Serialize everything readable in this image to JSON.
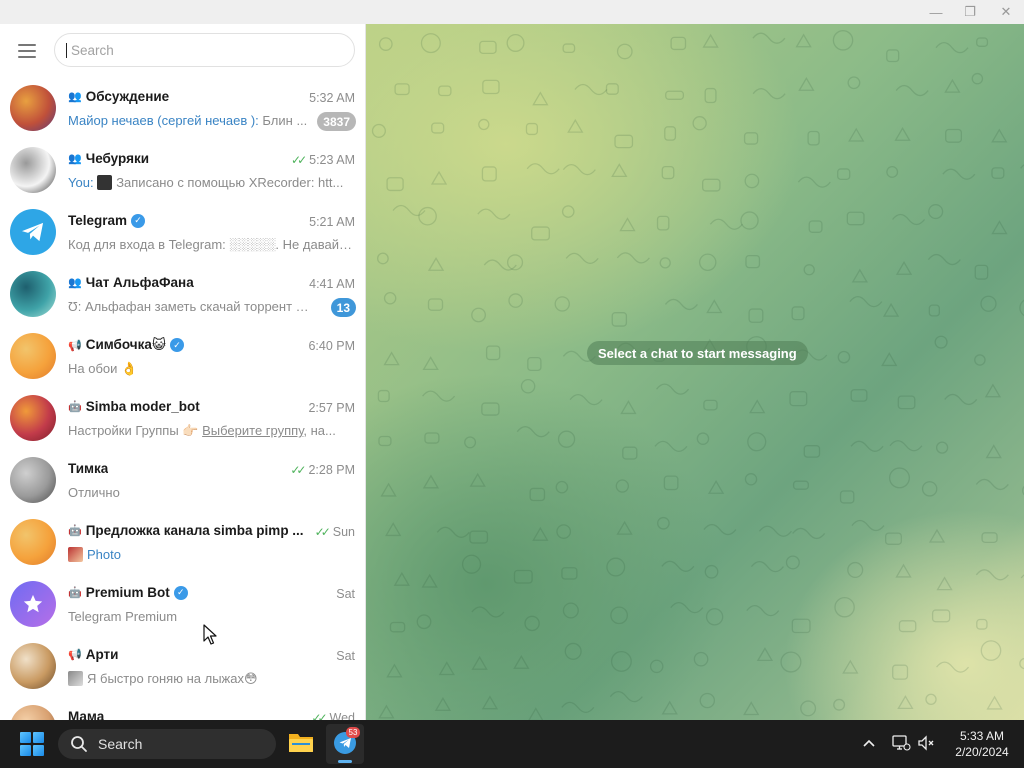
{
  "window": {
    "minimize_glyph": "—",
    "maximize_glyph": "❐",
    "close_glyph": "✕"
  },
  "sidebar": {
    "menu_icon": "hamburger-icon",
    "search": {
      "placeholder": "Search",
      "value": ""
    }
  },
  "chats": [
    {
      "name": "Обсуждение",
      "type": "group",
      "verified": false,
      "time": "5:32 AM",
      "status": "",
      "sender": "Майор нечаев (сергей нечаев ):",
      "preview": "Блин ...",
      "media": "",
      "badge": "3837",
      "badge_muted": true,
      "avatar_colors": [
        "#c0503a",
        "#e8a040",
        "#5a3a7a"
      ]
    },
    {
      "name": "Чебуряки",
      "type": "group",
      "verified": false,
      "time": "5:23 AM",
      "status": "read",
      "sender": "You:",
      "preview": "Записано с помощью XRecorder: htt...",
      "media": "thumb-dark",
      "badge": "",
      "badge_muted": false,
      "avatar_colors": [
        "#f4f4f4",
        "#999999",
        "#333333"
      ]
    },
    {
      "name": "Telegram",
      "type": "user",
      "verified": true,
      "time": "5:21 AM",
      "status": "",
      "sender": "",
      "preview": "Код для входа в Telegram: ░░░░░. Не давайте ...",
      "media": "",
      "badge": "",
      "badge_muted": false,
      "avatar_colors": [
        "#2ea6e6",
        "#2ea6e6",
        "#ffffff"
      ]
    },
    {
      "name": "Чат АльфаФана",
      "type": "group",
      "verified": false,
      "time": "4:41 AM",
      "status": "",
      "sender": "",
      "preview": "Ʊ: Альфафан заметь скачай торрент он...",
      "media": "",
      "badge": "13",
      "badge_muted": false,
      "avatar_colors": [
        "#3fa3a8",
        "#1e5f6e",
        "#a8e0d8"
      ]
    },
    {
      "name": "Симбочка😺",
      "type": "channel",
      "verified": true,
      "time": "6:40 PM",
      "status": "",
      "sender": "",
      "preview": "На обои 👌",
      "media": "",
      "badge": "",
      "badge_muted": false,
      "avatar_colors": [
        "#f5a23c",
        "#f2c46b",
        "#e07a2a"
      ]
    },
    {
      "name": "Simba moder_bot",
      "type": "bot",
      "verified": false,
      "time": "2:57 PM",
      "status": "",
      "sender": "",
      "preview": "Настройки Группы 👉🏻",
      "link": "Выберите группу",
      "preview_tail": ", на...",
      "media": "",
      "badge": "",
      "badge_muted": false,
      "avatar_colors": [
        "#c23b4a",
        "#f09a3a",
        "#7a1e2a"
      ]
    },
    {
      "name": "Тимка",
      "type": "user",
      "verified": false,
      "time": "2:28 PM",
      "status": "read",
      "sender": "",
      "preview": "Отлично",
      "media": "",
      "badge": "",
      "badge_muted": false,
      "avatar_colors": [
        "#9a9a9a",
        "#cfcfcf",
        "#4a4a4a"
      ]
    },
    {
      "name": "Предложка канала simba pimp ...",
      "type": "bot",
      "verified": false,
      "time": "Sun",
      "status": "read",
      "sender": "",
      "preview": "Photo",
      "media": "thumb-photo",
      "badge": "",
      "badge_muted": false,
      "preview_blue": true,
      "avatar_colors": [
        "#f5a23c",
        "#f2c46b",
        "#e07a2a"
      ]
    },
    {
      "name": "Premium Bot",
      "type": "bot",
      "verified": true,
      "time": "Sat",
      "status": "",
      "sender": "",
      "preview": "Telegram Premium",
      "media": "",
      "badge": "",
      "badge_muted": false,
      "avatar_colors": [
        "#6f6cf2",
        "#b66ee8",
        "#ffffff"
      ]
    },
    {
      "name": "Арти",
      "type": "channel",
      "verified": false,
      "time": "Sat",
      "status": "",
      "sender": "",
      "preview": "Я быстро гоняю на лыжах😳",
      "media": "thumb-small",
      "badge": "",
      "badge_muted": false,
      "avatar_colors": [
        "#c99a62",
        "#f0e0c8",
        "#6a4a2a"
      ]
    },
    {
      "name": "Мама",
      "type": "user",
      "verified": false,
      "time": "Wed",
      "status": "read",
      "sender": "",
      "preview": "",
      "media": "",
      "badge": "",
      "badge_muted": false,
      "avatar_colors": [
        "#d8a070",
        "#f4d0a8",
        "#7a4a2a"
      ]
    }
  ],
  "main": {
    "empty_message": "Select a chat to start messaging"
  },
  "taskbar": {
    "start_icon": "windows-start-icon",
    "search_label": "Search",
    "apps": [
      {
        "name": "File Explorer"
      },
      {
        "name": "Telegram",
        "badge": "53"
      }
    ],
    "tray_chevron": "^",
    "clock_time": "5:33 AM",
    "clock_date": "2/20/2024"
  }
}
